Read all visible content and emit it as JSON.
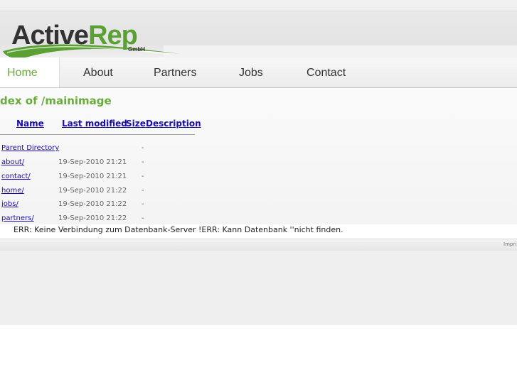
{
  "logo": {
    "part1": "Active",
    "part2": "Rep",
    "suffix": "GmbH"
  },
  "nav": [
    {
      "label": "Home",
      "active": true
    },
    {
      "label": "About"
    },
    {
      "label": "Partners"
    },
    {
      "label": "Jobs"
    },
    {
      "label": "Contact"
    }
  ],
  "listing": {
    "title": "dex of /mainimage",
    "columns": {
      "name": "Name",
      "modified": "Last modified",
      "size": "Size",
      "description": "Description"
    },
    "rows": [
      {
        "name": "Parent Directory",
        "modified": "",
        "size": "-"
      },
      {
        "name": "about/",
        "modified": "19-Sep-2010 21:21",
        "size": "-"
      },
      {
        "name": "contact/",
        "modified": "19-Sep-2010 21:21",
        "size": "-"
      },
      {
        "name": "home/",
        "modified": "19-Sep-2010 21:22",
        "size": "-"
      },
      {
        "name": "jobs/",
        "modified": "19-Sep-2010 21:22",
        "size": "-"
      },
      {
        "name": "partners/",
        "modified": "19-Sep-2010 21:22",
        "size": "-"
      }
    ]
  },
  "error_message": "ERR: Keine Verbindung zum Datenbank-Server !ERR: Kann Datenbank ''nicht finden.",
  "footer": {
    "imprint": "Impri"
  },
  "colors": {
    "brand_green": "#6aab3d",
    "logo_dark": "#333333",
    "link": "#1a0dab"
  }
}
